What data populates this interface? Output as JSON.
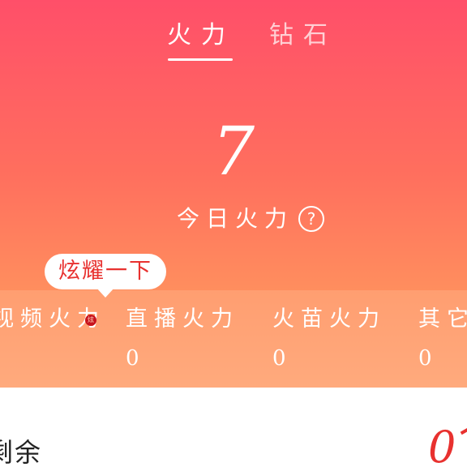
{
  "tabs": {
    "firepower": "火力",
    "diamond": "钻石"
  },
  "summary": {
    "today_value": "7",
    "today_label": "今日火力",
    "help_icon": "question-circle-icon"
  },
  "tooltip": {
    "text": "炫耀一下"
  },
  "stats": [
    {
      "label": "视频火力",
      "value": "",
      "badge": "炫"
    },
    {
      "label": "直播火力",
      "value": "0"
    },
    {
      "label": "火苗火力",
      "value": "0"
    },
    {
      "label": "其它",
      "value": "0"
    }
  ],
  "remaining": {
    "label": "剩余",
    "value": "0"
  },
  "colors": {
    "gradient_top": "#ff4f69",
    "gradient_bottom": "#ffa070",
    "accent_red": "#e8312f"
  }
}
